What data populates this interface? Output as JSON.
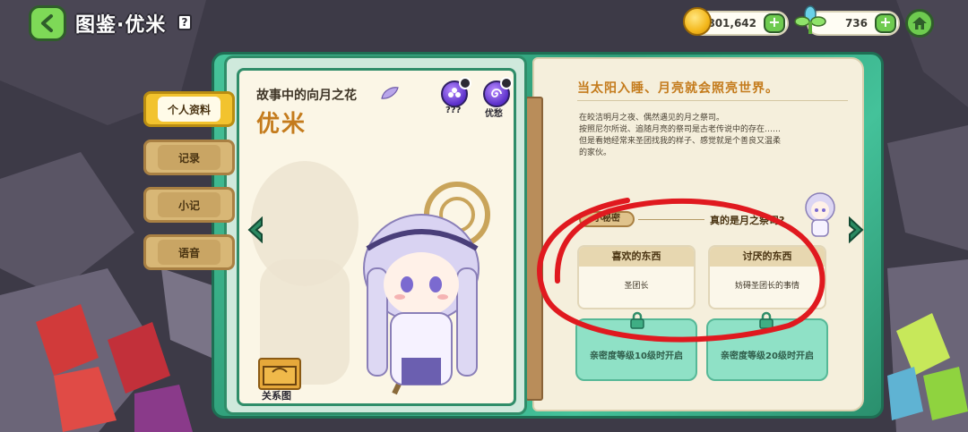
{
  "header": {
    "title": "图鉴·优米",
    "help_label": "?",
    "coins": "801,642",
    "gems": "736",
    "plus_label": "+"
  },
  "side_tabs": [
    {
      "label": "个人资料",
      "active": true
    },
    {
      "label": "记录",
      "active": false
    },
    {
      "label": "小记",
      "active": false
    },
    {
      "label": "语音",
      "active": false
    }
  ],
  "profile": {
    "subtitle": "故事中的向月之花",
    "name": "优米",
    "badge_1_label": "???",
    "badge_2_label": "优愁",
    "relation_label": "关系图"
  },
  "detail": {
    "headline": "当太阳入睡、月亮就会照亮世界。",
    "description": [
      "在皎洁明月之夜、偶然遇见的月之祭司。",
      "按照尼尔所说、追随月亮的祭司是古老传说中的存在……",
      "但是看她经常来圣团找我的样子、感觉就是个善良又温柔",
      "的家伙。"
    ],
    "trivia_tag": "小秘密",
    "trivia_question": "真的是月之祭司?",
    "likes_title": "喜欢的东西",
    "likes_value": "圣团长",
    "dislikes_title": "讨厌的东西",
    "dislikes_value": "妨碍圣团长的事情",
    "locked_left": "亲密度等级10级时开启",
    "locked_right": "亲密度等级20级时开启"
  },
  "colors": {
    "accent_green": "#6ecb4f",
    "frame_teal": "#2f9e79",
    "name_orange": "#c47b1c",
    "annotation_red": "#e0191f"
  }
}
